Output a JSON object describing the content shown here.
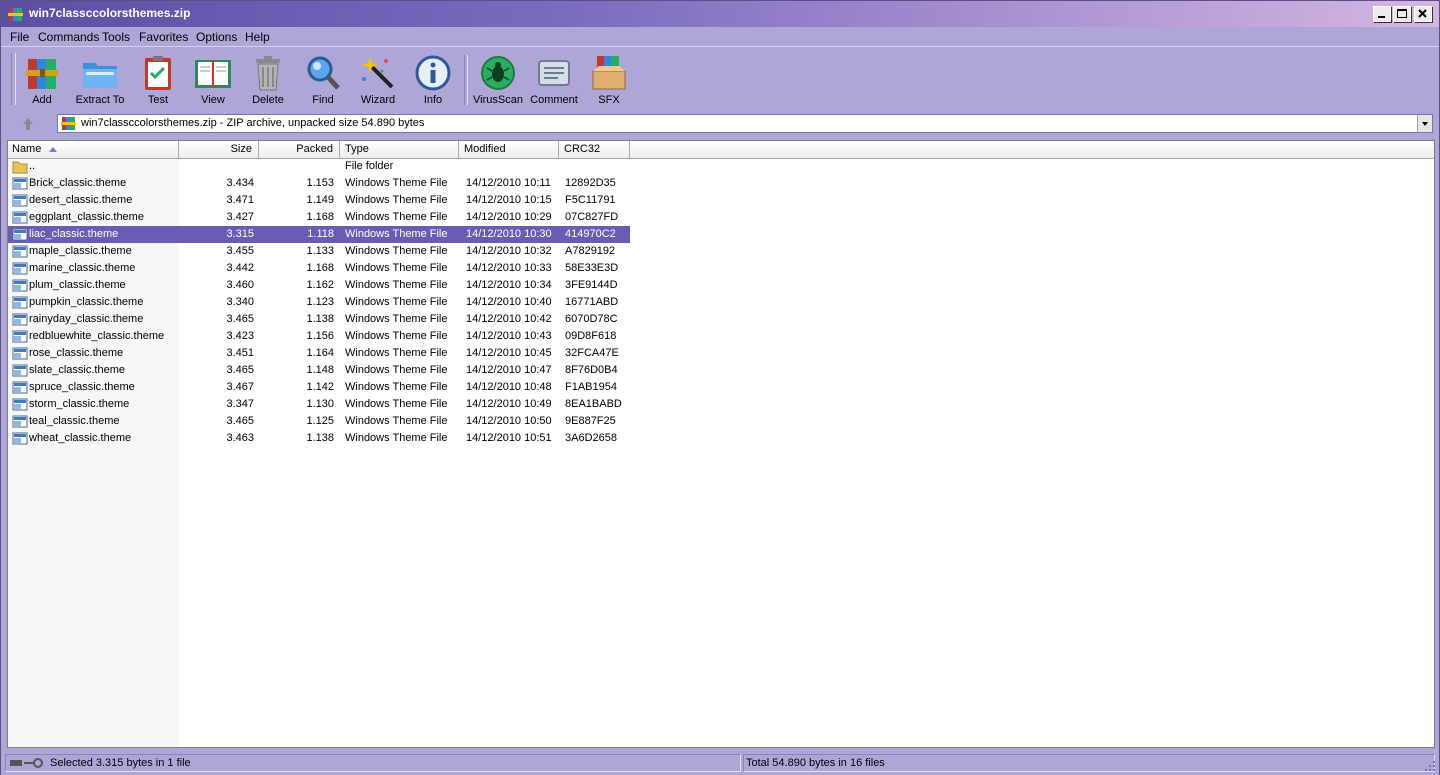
{
  "window": {
    "title": "win7classccolorsthemes.zip"
  },
  "menu": [
    {
      "label": "File"
    },
    {
      "label": "Commands"
    },
    {
      "label": "Tools"
    },
    {
      "label": "Favorites"
    },
    {
      "label": "Options"
    },
    {
      "label": "Help"
    }
  ],
  "toolbar": {
    "buttons": [
      {
        "label": "Add",
        "icon": "books-add-icon"
      },
      {
        "label": "Extract To",
        "icon": "folder-extract-icon"
      },
      {
        "label": "Test",
        "icon": "clipboard-test-icon"
      },
      {
        "label": "View",
        "icon": "book-view-icon"
      },
      {
        "label": "Delete",
        "icon": "trash-icon"
      },
      {
        "label": "Find",
        "icon": "magnifier-icon"
      },
      {
        "label": "Wizard",
        "icon": "wand-icon"
      },
      {
        "label": "Info",
        "icon": "info-icon"
      },
      {
        "label": "VirusScan",
        "icon": "bug-icon"
      },
      {
        "label": "Comment",
        "icon": "comment-icon"
      },
      {
        "label": "SFX",
        "icon": "sfx-box-icon"
      }
    ]
  },
  "address": {
    "text": "win7classccolorsthemes.zip - ZIP archive, unpacked size 54.890 bytes"
  },
  "columns": {
    "name": "Name",
    "size": "Size",
    "packed": "Packed",
    "type": "Type",
    "modified": "Modified",
    "crc": "CRC32"
  },
  "files": [
    {
      "name": "..",
      "size": "",
      "packed": "",
      "type": "File folder",
      "modified": "",
      "crc": "",
      "kind": "folder"
    },
    {
      "name": "Brick_classic.theme",
      "size": "3.434",
      "packed": "1.153",
      "type": "Windows Theme File",
      "modified": "14/12/2010 10:11",
      "crc": "12892D35",
      "kind": "file"
    },
    {
      "name": "desert_classic.theme",
      "size": "3.471",
      "packed": "1.149",
      "type": "Windows Theme File",
      "modified": "14/12/2010 10:15",
      "crc": "F5C11791",
      "kind": "file"
    },
    {
      "name": "eggplant_classic.theme",
      "size": "3.427",
      "packed": "1.168",
      "type": "Windows Theme File",
      "modified": "14/12/2010 10:29",
      "crc": "07C827FD",
      "kind": "file"
    },
    {
      "name": "liac_classic.theme",
      "size": "3.315",
      "packed": "1.118",
      "type": "Windows Theme File",
      "modified": "14/12/2010 10:30",
      "crc": "414970C2",
      "kind": "file",
      "selected": true
    },
    {
      "name": "maple_classic.theme",
      "size": "3.455",
      "packed": "1.133",
      "type": "Windows Theme File",
      "modified": "14/12/2010 10:32",
      "crc": "A7829192",
      "kind": "file"
    },
    {
      "name": "marine_classic.theme",
      "size": "3.442",
      "packed": "1.168",
      "type": "Windows Theme File",
      "modified": "14/12/2010 10:33",
      "crc": "58E33E3D",
      "kind": "file"
    },
    {
      "name": "plum_classic.theme",
      "size": "3.460",
      "packed": "1.162",
      "type": "Windows Theme File",
      "modified": "14/12/2010 10:34",
      "crc": "3FE9144D",
      "kind": "file"
    },
    {
      "name": "pumpkin_classic.theme",
      "size": "3.340",
      "packed": "1.123",
      "type": "Windows Theme File",
      "modified": "14/12/2010 10:40",
      "crc": "16771ABD",
      "kind": "file"
    },
    {
      "name": "rainyday_classic.theme",
      "size": "3.465",
      "packed": "1.138",
      "type": "Windows Theme File",
      "modified": "14/12/2010 10:42",
      "crc": "6070D78C",
      "kind": "file"
    },
    {
      "name": "redbluewhite_classic.theme",
      "size": "3.423",
      "packed": "1.156",
      "type": "Windows Theme File",
      "modified": "14/12/2010 10:43",
      "crc": "09D8F618",
      "kind": "file"
    },
    {
      "name": "rose_classic.theme",
      "size": "3.451",
      "packed": "1.164",
      "type": "Windows Theme File",
      "modified": "14/12/2010 10:45",
      "crc": "32FCA47E",
      "kind": "file"
    },
    {
      "name": "slate_classic.theme",
      "size": "3.465",
      "packed": "1.148",
      "type": "Windows Theme File",
      "modified": "14/12/2010 10:47",
      "crc": "8F76D0B4",
      "kind": "file"
    },
    {
      "name": "spruce_classic.theme",
      "size": "3.467",
      "packed": "1.142",
      "type": "Windows Theme File",
      "modified": "14/12/2010 10:48",
      "crc": "F1AB1954",
      "kind": "file"
    },
    {
      "name": "storm_classic.theme",
      "size": "3.347",
      "packed": "1.130",
      "type": "Windows Theme File",
      "modified": "14/12/2010 10:49",
      "crc": "8EA1BABD",
      "kind": "file"
    },
    {
      "name": "teal_classic.theme",
      "size": "3.465",
      "packed": "1.125",
      "type": "Windows Theme File",
      "modified": "14/12/2010 10:50",
      "crc": "9E887F25",
      "kind": "file"
    },
    {
      "name": "wheat_classic.theme",
      "size": "3.463",
      "packed": "1.138",
      "type": "Windows Theme File",
      "modified": "14/12/2010 10:51",
      "crc": "3A6D2658",
      "kind": "file"
    }
  ],
  "status": {
    "left": "Selected 3.315 bytes in 1 file",
    "right": "Total 54.890 bytes in 16 files"
  },
  "colors": {
    "accent": "#6a5bb5",
    "frame": "#aea6d6"
  }
}
